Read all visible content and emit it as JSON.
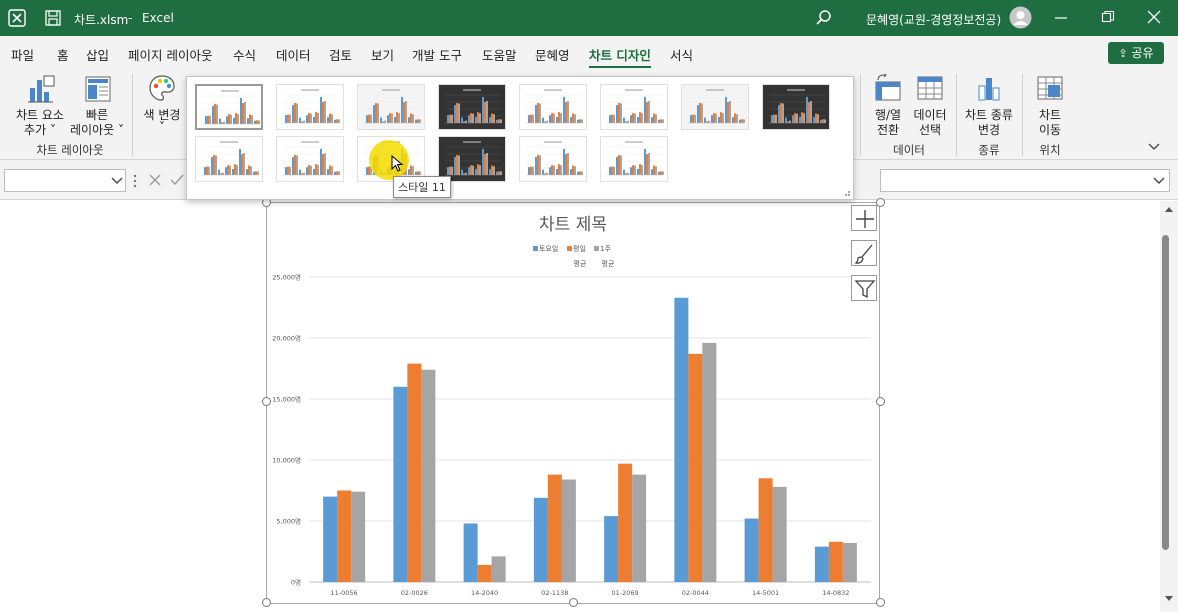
{
  "titlebar": {
    "filename": "차트.xlsm",
    "separator": "-",
    "app": "Excel",
    "user": "문혜영(교원-경영정보전공)",
    "icons": [
      "excel-logo-icon",
      "save-icon",
      "search-icon",
      "avatar-icon",
      "minimize-icon",
      "restore-icon",
      "close-icon"
    ]
  },
  "tabs": [
    "파일",
    "홈",
    "삽입",
    "페이지 레이아웃",
    "수식",
    "데이터",
    "검토",
    "보기",
    "개발 도구",
    "도움말",
    "문혜영",
    "차트 디자인",
    "서식"
  ],
  "active_tab": "차트 디자인",
  "share_label": "공유",
  "ribbon": {
    "add_element": [
      "차트 요소",
      "추가 ˅"
    ],
    "quick_layout": [
      "빠른",
      "레이아웃 ˅"
    ],
    "change_colors": [
      "색 변경",
      "˅"
    ],
    "group_chart_layouts": "차트 레이아웃",
    "switch_row_col": [
      "행/열",
      "전환"
    ],
    "select_data": [
      "데이터",
      "선택"
    ],
    "group_data": "데이터",
    "change_type": [
      "차트 종류",
      "변경"
    ],
    "group_type": "종류",
    "move_chart": [
      "차트",
      "이동"
    ],
    "group_location": "위치"
  },
  "gallery": {
    "tooltip": "스타일 11",
    "selected_index": 0,
    "hover_index": 10,
    "dark_indices": [
      3,
      7,
      11
    ]
  },
  "chart": {
    "title": "차트 제목",
    "series_colors": [
      "#5b9bd5",
      "#ed7d31",
      "#a5a5a5"
    ]
  },
  "chart_data": {
    "type": "bar",
    "title": "차트 제목",
    "categories": [
      "11-0056",
      "02-0026",
      "14-2040",
      "02-1138",
      "01-2069",
      "02-0044",
      "14-5001",
      "14-0832"
    ],
    "series": [
      {
        "name": "토요일",
        "values": [
          7000,
          16000,
          4800,
          6900,
          5400,
          23300,
          5200,
          2900
        ]
      },
      {
        "name": "평일 평균",
        "values": [
          7500,
          17900,
          1400,
          8800,
          9700,
          18700,
          8500,
          3300
        ]
      },
      {
        "name": "1주 평균",
        "values": [
          7400,
          17400,
          2100,
          8400,
          8800,
          19600,
          7800,
          3200
        ]
      }
    ],
    "legend_labels": [
      "토요일",
      "평일",
      "1주"
    ],
    "legend_sub": [
      "평균",
      "평균"
    ],
    "ylim": [
      0,
      25000
    ],
    "yticks": [
      "0명",
      "5,000명",
      "10,000명",
      "15,000명",
      "20,000명",
      "25,000명"
    ],
    "grid": true,
    "legend_position": "top"
  }
}
